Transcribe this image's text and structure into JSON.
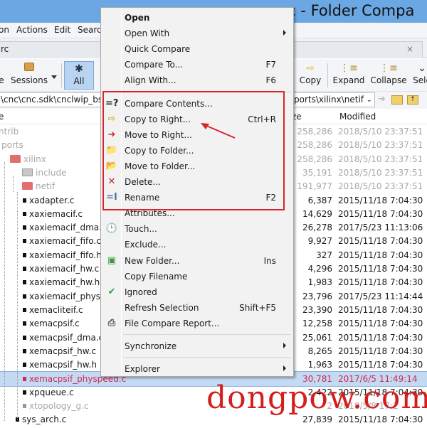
{
  "window": {
    "title": "src - Folder Compa"
  },
  "menubar": [
    "on",
    "Actions",
    "Edit",
    "Searc"
  ],
  "tab": {
    "label": "rc",
    "close": "×"
  },
  "toolbar": {
    "session_partial": "e",
    "sessions": "Sessions",
    "all": "All",
    "copy": "Copy",
    "expand": "Expand",
    "collapse": "Collapse",
    "select_partial": "Sele"
  },
  "path": {
    "left": "\\cnc\\cnc.sdk\\cnclwip_bsp",
    "right": "ports\\xilinx\\netif"
  },
  "columns": {
    "name_partial": "e",
    "size_partial": "ze",
    "modified": "Modified"
  },
  "rows": [
    {
      "name": "ntrib",
      "size": "258,286",
      "modified": "2018/5/10 23:37:51",
      "state": "grey",
      "kind": "none"
    },
    {
      "name": "ports",
      "size": "258,286",
      "modified": "2018/5/10 23:37:51",
      "state": "grey",
      "kind": "none"
    },
    {
      "name": "xilinx",
      "size": "258,286",
      "modified": "2018/5/10 23:37:51",
      "state": "grey",
      "kind": "folder-open"
    },
    {
      "name": "include",
      "size": "35,191",
      "modified": "2018/5/10 23:37:51",
      "state": "grey",
      "kind": "folder-closed"
    },
    {
      "name": "netif",
      "size": "191,977",
      "modified": "2018/5/10 23:37:51",
      "state": "grey",
      "kind": "folder-open"
    },
    {
      "name": "xadapter.c",
      "size": "6,387",
      "modified": "2015/11/18 7:04:30",
      "state": "normal",
      "kind": "file"
    },
    {
      "name": "xaxiemacif.c",
      "size": "14,629",
      "modified": "2015/11/18 7:04:30",
      "state": "normal",
      "kind": "file"
    },
    {
      "name": "xaxiemacif_dma.c",
      "size": "26,278",
      "modified": "2017/5/23 11:13:06",
      "state": "normal",
      "kind": "file"
    },
    {
      "name": "xaxiemacif_fifo.c",
      "size": "9,927",
      "modified": "2015/11/18 7:04:30",
      "state": "normal",
      "kind": "file"
    },
    {
      "name": "xaxiemacif_fifo.h",
      "size": "327",
      "modified": "2015/11/18 7:04:30",
      "state": "normal",
      "kind": "file"
    },
    {
      "name": "xaxiemacif_hw.c",
      "size": "4,296",
      "modified": "2015/11/18 7:04:30",
      "state": "normal",
      "kind": "file"
    },
    {
      "name": "xaxiemacif_hw.h",
      "size": "1,983",
      "modified": "2015/11/18 7:04:30",
      "state": "normal",
      "kind": "file"
    },
    {
      "name": "xaxiemacif_physpe",
      "size": "23,796",
      "modified": "2017/5/23 11:14:44",
      "state": "normal",
      "kind": "file"
    },
    {
      "name": "xemacliteif.c",
      "size": "23,390",
      "modified": "2015/11/18 7:04:30",
      "state": "normal",
      "kind": "file"
    },
    {
      "name": "xemacpsif.c",
      "size": "12,258",
      "modified": "2015/11/18 7:04:30",
      "state": "normal",
      "kind": "file"
    },
    {
      "name": "xemacpsif_dma.c",
      "size": "25,061",
      "modified": "2015/11/18 7:04:30",
      "state": "normal",
      "kind": "file"
    },
    {
      "name": "xemacpsif_hw.c",
      "size": "8,265",
      "modified": "2015/11/18 7:04:30",
      "state": "normal",
      "kind": "file"
    },
    {
      "name": "xemacpsif_hw.h",
      "size": "1,963",
      "modified": "2015/11/18 7:04:30",
      "state": "normal",
      "kind": "file"
    },
    {
      "name": "xemacpsif_physpeed.c",
      "size": "30,781",
      "modified": "2017/6/5 11:49:14",
      "state": "red",
      "kind": "file",
      "selected": true
    },
    {
      "name": "xpqueue.c",
      "size": "2,422",
      "modified": "2015/11/18 7:04:30",
      "state": "normal",
      "kind": "file"
    },
    {
      "name": "xtopology_g.c",
      "size": "2",
      "modified": "2018/5/8 17:2",
      "state": "grey",
      "kind": "file"
    },
    {
      "name": "sys_arch.c",
      "size": "27,839",
      "modified": "2015/11/18 7:04:30",
      "state": "normal",
      "kind": "file"
    }
  ],
  "context_menu": {
    "items": [
      {
        "label": "Open",
        "bold": true
      },
      {
        "label": "Open With",
        "submenu": true
      },
      {
        "label": "Quick Compare"
      },
      {
        "label": "Compare To...",
        "shortcut": "F7"
      },
      {
        "label": "Align With...",
        "shortcut": "F6"
      },
      {
        "sep": true
      },
      {
        "label": "Compare Contents...",
        "icon": "compare-contents-icon",
        "glyph": "=?"
      },
      {
        "label": "Copy to Right...",
        "shortcut": "Ctrl+R",
        "icon": "copy-right-arrow-icon",
        "glyph": "⇨"
      },
      {
        "label": "Move to Right...",
        "icon": "move-right-arrow-icon",
        "glyph": "➜"
      },
      {
        "label": "Copy to Folder...",
        "icon": "copy-to-folder-icon",
        "glyph": "📁"
      },
      {
        "label": "Move to Folder...",
        "icon": "move-to-folder-icon",
        "glyph": "📂"
      },
      {
        "label": "Delete...",
        "icon": "delete-x-icon",
        "glyph": "✕"
      },
      {
        "label": "Rename",
        "shortcut": "F2",
        "icon": "rename-icon",
        "glyph": "=I"
      },
      {
        "label": "Attributes..."
      },
      {
        "label": "Touch...",
        "icon": "touch-clock-icon",
        "glyph": "🕒"
      },
      {
        "label": "Exclude..."
      },
      {
        "label": "New Folder...",
        "shortcut": "Ins",
        "icon": "new-folder-icon",
        "glyph": "▣"
      },
      {
        "label": "Copy Filename"
      },
      {
        "label": "Ignored",
        "icon": "check-icon",
        "glyph": "✔"
      },
      {
        "label": "Refresh Selection",
        "shortcut": "Shift+F5"
      },
      {
        "label": "File Compare Report...",
        "icon": "printer-icon",
        "glyph": "⎙"
      },
      {
        "sep": true
      },
      {
        "label": "Synchronize",
        "submenu": true
      },
      {
        "sep": true
      },
      {
        "label": "Explorer",
        "submenu": true
      }
    ]
  },
  "watermark": "dongpow.com",
  "colors": {
    "title_bar": "#6ba7e3",
    "highlight_box": "#d9262e",
    "selected_row": "#c4daf2",
    "changed_text": "#d0285a"
  }
}
